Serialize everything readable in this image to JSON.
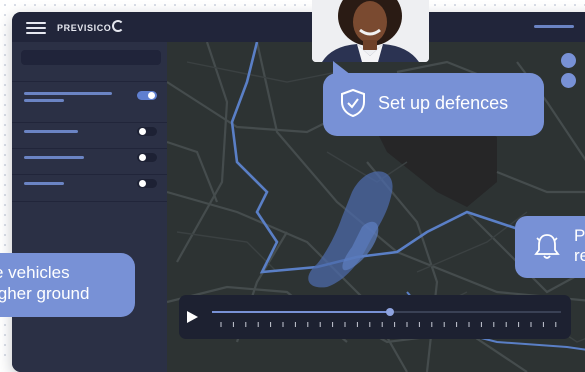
{
  "app": {
    "brand": "PREVISICO"
  },
  "sidebar": {
    "toggles": [
      {
        "state": "on"
      },
      {
        "state": "off"
      },
      {
        "state": "off"
      },
      {
        "state": "off"
      }
    ]
  },
  "notifications": {
    "defences": {
      "label": "Set up defences",
      "icon": "shield-check-icon"
    },
    "vehicles": {
      "label": "e vehicles\nigher ground"
    },
    "alert": {
      "label": "P\nre",
      "icon": "bell-icon"
    }
  },
  "timeline": {
    "progress": 0.51
  },
  "colors": {
    "accent": "#7891d6",
    "toggle_on": "#5f7fd0",
    "map_road": "#3f4647",
    "river": "#5a7fc6",
    "flood": "#4c6aa8"
  }
}
